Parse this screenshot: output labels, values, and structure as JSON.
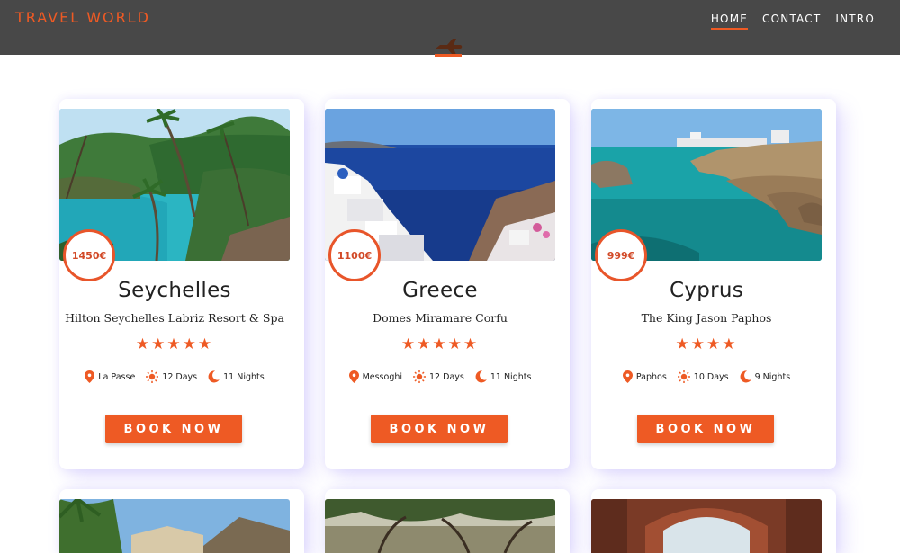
{
  "header": {
    "brand": "TRAVEL WORLD",
    "nav": [
      {
        "label": "HOME",
        "active": true
      },
      {
        "label": "CONTACT",
        "active": false
      },
      {
        "label": "INTRO",
        "active": false
      }
    ],
    "accent_color": "#ee5a24",
    "bg_color": "#484848"
  },
  "cards": [
    {
      "price": "1450€",
      "destination": "Seychelles",
      "hotel": "Hilton Seychelles Labriz Resort & Spa",
      "stars": "★★★★★",
      "location": "La Passe",
      "days": "12 Days",
      "nights": "11 Nights",
      "button": "BOOK NOW"
    },
    {
      "price": "1100€",
      "destination": "Greece",
      "hotel": "Domes Miramare Corfu",
      "stars": "★★★★★",
      "location": "Messoghi",
      "days": "12 Days",
      "nights": "11 Nights",
      "button": "BOOK NOW"
    },
    {
      "price": "999€",
      "destination": "Cyprus",
      "hotel": "The King Jason Paphos",
      "stars": "★★★★",
      "location": "Paphos",
      "days": "10 Days",
      "nights": "9 Nights",
      "button": "BOOK NOW"
    }
  ],
  "icons": {
    "location": "map-pin-icon",
    "days": "sun-icon",
    "nights": "moon-icon",
    "plane": "airplane-icon"
  }
}
